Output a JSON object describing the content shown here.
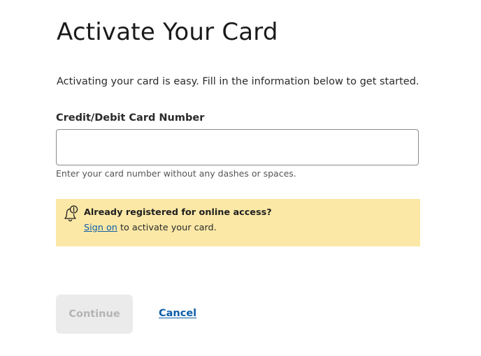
{
  "page": {
    "title": "Activate Your Card",
    "intro": "Activating your card is easy. Fill in the information below to get started."
  },
  "card_field": {
    "label": "Credit/Debit Card Number",
    "value": "",
    "placeholder": "",
    "hint": "Enter your card number without any dashes or spaces."
  },
  "notice": {
    "icon": "bell-icon",
    "title": "Already registered for online access?",
    "link_text": "Sign on",
    "suffix": "to activate your card.",
    "background": "#fbe8a6",
    "link_color": "#0d5ea8"
  },
  "actions": {
    "continue_label": "Continue",
    "continue_enabled": false,
    "cancel_label": "Cancel"
  }
}
